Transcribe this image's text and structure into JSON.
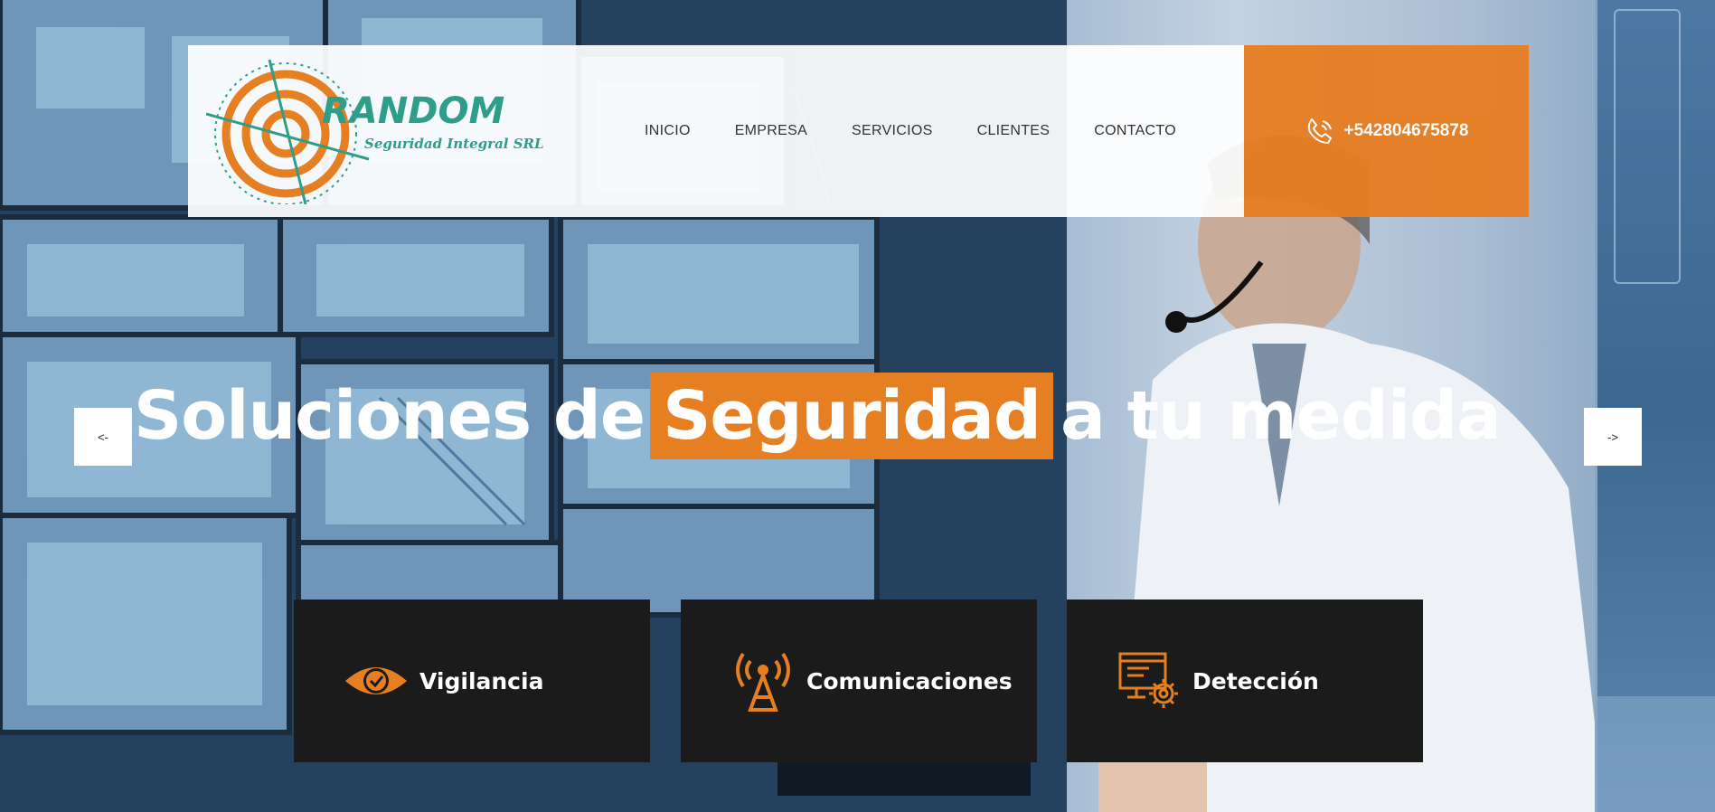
{
  "nav": {
    "items": [
      {
        "label": "INICIO"
      },
      {
        "label": "EMPRESA"
      },
      {
        "label": "SERVICIOS"
      },
      {
        "label": "CLIENTES"
      },
      {
        "label": "CONTACTO"
      }
    ]
  },
  "logo": {
    "title": "RANDOM",
    "subtitle": "Seguridad Integral SRL"
  },
  "phone": {
    "number": "+542804675878",
    "icon": "phone-icon"
  },
  "hero": {
    "headline_before": "Soluciones de",
    "headline_highlight": "Seguridad",
    "headline_after": "a tu medida",
    "prev_label": "<-",
    "next_label": "->"
  },
  "services": [
    {
      "label": "Vigilancia",
      "icon": "eye-check-icon"
    },
    {
      "label": "Comunicaciones",
      "icon": "antenna-icon"
    },
    {
      "label": "Detección",
      "icon": "monitor-gear-icon"
    }
  ],
  "colors": {
    "accent": "#e67e22",
    "card_bg": "#1b1b1b",
    "logo_green": "#2e9e8a"
  }
}
